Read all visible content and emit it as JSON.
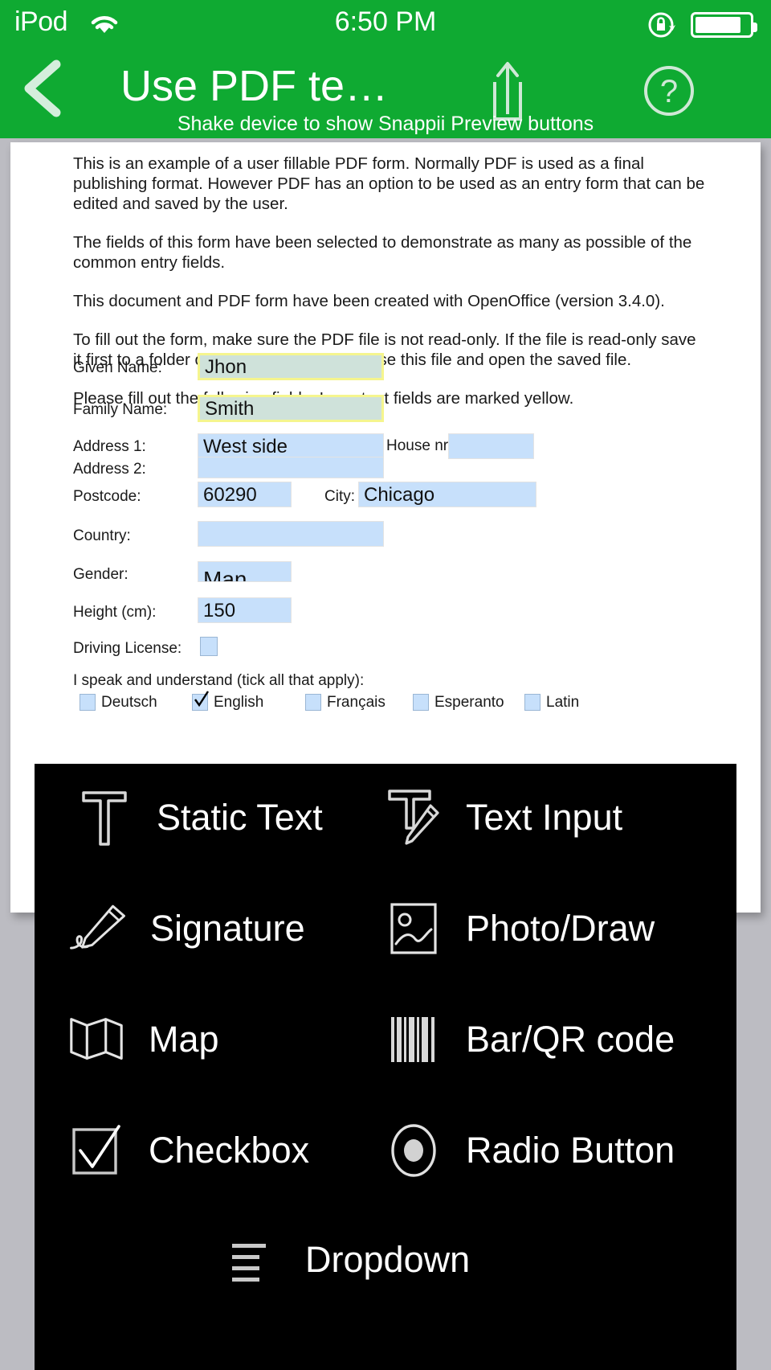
{
  "statusbar": {
    "carrier": "iPod",
    "wifi_icon": "wifi-icon",
    "time": "6:50 PM",
    "rotation_lock_icon": "rotation-lock-icon",
    "battery_icon": "battery-icon"
  },
  "navbar": {
    "back_icon": "chevron-left-icon",
    "title": "Use PDF te…",
    "subtitle": "Shake device to show Snappii Preview buttons",
    "share_icon": "share-icon",
    "help_icon": "question-mark-icon"
  },
  "document": {
    "paragraphs": [
      "This is an example of a user fillable PDF form. Normally PDF is used as a final publishing format. However PDF has an option to be used as an entry form that can be edited and saved by the user.",
      "The fields of this form have been selected to demonstrate as many as possible of the common entry fields.",
      "This document and PDF form have been created with OpenOffice (version 3.4.0).",
      "To fill out the form, make sure the PDF file is not read-only. If the file is read-only save it first to a folder or computer desktop. Close this file and open the saved file.",
      "Please fill out the following fields. Important fields are marked yellow."
    ]
  },
  "form": {
    "given_name": {
      "label": "Given Name:",
      "value": "Jhon"
    },
    "family_name": {
      "label": "Family Name:",
      "value": "Smith"
    },
    "address1": {
      "label": "Address 1:",
      "value": "West side"
    },
    "house_nr": {
      "label": "House nr:",
      "value": ""
    },
    "address2": {
      "label": "Address 2:",
      "value": ""
    },
    "postcode": {
      "label": "Postcode:",
      "value": "60290"
    },
    "city": {
      "label": "City:",
      "value": "Chicago"
    },
    "country": {
      "label": "Country:",
      "value": ""
    },
    "gender": {
      "label": "Gender:",
      "value": "Man"
    },
    "height": {
      "label": "Height (cm):",
      "value": "150"
    },
    "driving_license": {
      "label": "Driving License:",
      "checked": false
    },
    "languages": {
      "title": "I speak and understand (tick all that apply):",
      "options": [
        {
          "label": "Deutsch",
          "checked": false
        },
        {
          "label": "English",
          "checked": true
        },
        {
          "label": "Français",
          "checked": false
        },
        {
          "label": "Esperanto",
          "checked": false
        },
        {
          "label": "Latin",
          "checked": false
        }
      ]
    }
  },
  "tool_panel": {
    "background": "#000000",
    "items": [
      {
        "label": "Static Text",
        "icon": "static-text-icon"
      },
      {
        "label": "Text Input",
        "icon": "text-input-icon"
      },
      {
        "label": "Signature",
        "icon": "signature-icon"
      },
      {
        "label": "Photo/Draw",
        "icon": "photo-draw-icon"
      },
      {
        "label": "Map",
        "icon": "map-icon"
      },
      {
        "label": "Bar/QR code",
        "icon": "barcode-icon"
      },
      {
        "label": "Checkbox",
        "icon": "checkbox-icon"
      },
      {
        "label": "Radio Button",
        "icon": "radio-button-icon"
      },
      {
        "label": "Dropdown",
        "icon": "dropdown-icon"
      }
    ]
  },
  "colors": {
    "header_green": "#0faa32",
    "page_white": "#ffffff",
    "desktop_gray": "#bcbcc2",
    "field_blue": "#c7e0fb",
    "field_required": "#cfe2da",
    "field_required_border": "#f5f58e"
  }
}
